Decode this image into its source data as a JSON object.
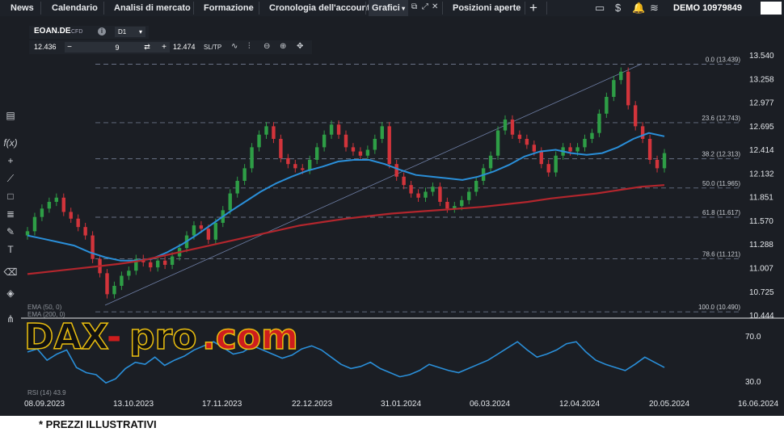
{
  "nav": {
    "news": "News",
    "calendar": "Calendario",
    "market_analysis": "Analisi di mercato",
    "training": "Formazione",
    "account_history": "Cronologia dell'account",
    "charts": "Grafici",
    "open_positions": "Posizioni aperte",
    "add_tab": "+"
  },
  "account": {
    "label": "DEMO",
    "number": "10979849"
  },
  "instrument": {
    "name": "EOAN.DE",
    "type": "CFD",
    "timeframe": "D1",
    "sell_price": "12.436",
    "quantity": "9",
    "buy_price": "12.474",
    "sltp_label": "SL/TP"
  },
  "colors": {
    "background": "#1b1e24",
    "toolbar": "#1d2128",
    "bullish": "#2e9e46",
    "bearish": "#d2343b",
    "ema_fast": "#2a8fd9",
    "ema_slow": "#b3262d",
    "fib": "#6a7386",
    "watermark_black": "#111111",
    "watermark_red": "#d41d1d",
    "watermark_gold": "#f1c40f"
  },
  "chart_data": {
    "type": "candlestick",
    "symbol": "EOAN.DE",
    "timeframe": "D1",
    "price_axis": [
      "13.540",
      "13.258",
      "12.977",
      "12.695",
      "12.414",
      "12.132",
      "11.851",
      "11.570",
      "11.288",
      "11.007",
      "10.725",
      "10.444"
    ],
    "price_range": [
      10.444,
      13.54
    ],
    "date_axis": [
      "08.09.2023",
      "13.10.2023",
      "17.11.2023",
      "22.12.2023",
      "31.01.2024",
      "06.03.2024",
      "12.04.2024",
      "20.05.2024",
      "16.06.2024"
    ],
    "fibonacci": [
      {
        "label": "0.0 (13.439)",
        "value": 13.439
      },
      {
        "label": "23.6 (12.743)",
        "value": 12.743
      },
      {
        "label": "38.2 (12.313)",
        "value": 12.313
      },
      {
        "label": "50.0 (11.965)",
        "value": 11.965
      },
      {
        "label": "61.8 (11.617)",
        "value": 11.617
      },
      {
        "label": "78.6 (11.121)",
        "value": 11.121
      },
      {
        "label": "100.0 (10.490)",
        "value": 10.49
      }
    ],
    "close_series": [
      11.45,
      11.62,
      11.72,
      11.8,
      11.85,
      11.68,
      11.6,
      11.5,
      11.4,
      11.12,
      10.95,
      10.7,
      10.8,
      10.92,
      10.98,
      11.12,
      11.08,
      11.02,
      11.1,
      11.05,
      11.15,
      11.25,
      11.4,
      11.52,
      11.48,
      11.35,
      11.55,
      11.7,
      11.9,
      12.05,
      12.2,
      12.45,
      12.6,
      12.7,
      12.55,
      12.32,
      12.25,
      12.2,
      12.18,
      12.3,
      12.45,
      12.6,
      12.72,
      12.6,
      12.45,
      12.4,
      12.35,
      12.42,
      12.55,
      12.7,
      12.25,
      12.1,
      12.0,
      11.9,
      11.85,
      11.92,
      11.98,
      11.8,
      11.72,
      11.75,
      11.82,
      11.92,
      12.05,
      12.2,
      12.35,
      12.65,
      12.78,
      12.6,
      12.55,
      12.48,
      12.4,
      12.25,
      12.15,
      12.35,
      12.45,
      12.4,
      12.45,
      12.55,
      12.62,
      12.85,
      13.05,
      13.25,
      13.35,
      12.95,
      12.7,
      12.55,
      12.3,
      12.2,
      12.38
    ],
    "ema_fast": {
      "label": "EMA (50, 0)",
      "values": [
        11.4,
        11.36,
        11.32,
        11.28,
        11.2,
        11.14,
        11.1,
        11.1,
        11.12,
        11.2,
        11.3,
        11.42,
        11.55,
        11.68,
        11.8,
        11.92,
        12.02,
        12.1,
        12.17,
        12.22,
        12.28,
        12.3,
        12.3,
        12.25,
        12.18,
        12.12,
        12.1,
        12.08,
        12.06,
        12.1,
        12.16,
        12.24,
        12.34,
        12.4,
        12.42,
        12.38,
        12.36,
        12.38,
        12.45,
        12.55,
        12.62,
        12.58
      ]
    },
    "ema_slow": {
      "label": "EMA (200, 0)",
      "values": [
        10.94,
        10.97,
        11.0,
        11.03,
        11.06,
        11.1,
        11.16,
        11.22,
        11.28,
        11.34,
        11.4,
        11.46,
        11.52,
        11.56,
        11.6,
        11.63,
        11.66,
        11.68,
        11.7,
        11.72,
        11.74,
        11.77,
        11.8,
        11.84,
        11.87,
        11.9,
        11.94,
        11.98,
        12.0
      ]
    },
    "rsi": {
      "label": "RSI (14)",
      "value": "43.9",
      "levels": [
        "70.0",
        "30.0"
      ],
      "values": [
        60,
        63,
        52,
        58,
        62,
        45,
        40,
        38,
        30,
        34,
        44,
        50,
        48,
        55,
        47,
        52,
        56,
        62,
        66,
        70,
        64,
        58,
        60,
        66,
        62,
        58,
        54,
        57,
        63,
        66,
        62,
        55,
        48,
        44,
        46,
        50,
        44,
        40,
        36,
        38,
        42,
        48,
        45,
        42,
        40,
        44,
        48,
        52,
        58,
        64,
        70,
        62,
        55,
        58,
        62,
        68,
        70,
        60,
        52,
        48,
        45,
        42,
        48,
        55,
        50,
        45
      ]
    },
    "fib_range": {
      "start": 10.49,
      "end": 13.439
    }
  },
  "indicators": {
    "ema1": "EMA (50, 0)",
    "ema2": "EMA (200, 0)",
    "rsi": "RSI (14) 43.9",
    "rsi_close": "✕"
  },
  "watermark": {
    "dax": "DAX",
    "dash": "-",
    "pro": "pro",
    "dot_com": ".com"
  },
  "footer": {
    "note": "* PREZZI ILLUSTRATIVI"
  },
  "icons": [
    "window-icon",
    "dollar-icon",
    "bell-icon",
    "wifi-icon",
    "add-tab-icon",
    "wave-icon",
    "zoom-out-icon",
    "zoom-in-icon",
    "move-icon"
  ]
}
